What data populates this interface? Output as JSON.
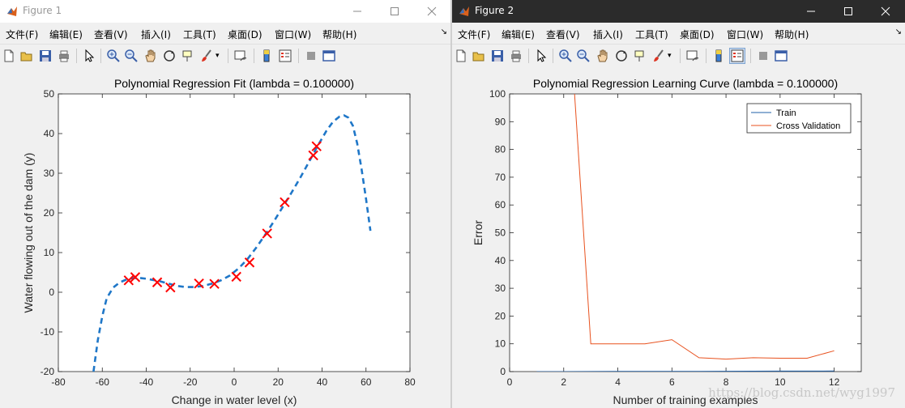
{
  "figure1": {
    "window_title": "Figure 1",
    "menu": [
      "文件(F)",
      "编辑(E)",
      "查看(V)",
      "插入(I)",
      "工具(T)",
      "桌面(D)",
      "窗口(W)",
      "帮助(H)"
    ],
    "overflow_arrow": "↘",
    "toolbar_icons": [
      "new-figure-icon",
      "open-file-icon",
      "save-icon",
      "print-icon",
      "pointer-icon",
      "zoom-in-icon",
      "zoom-out-icon",
      "pan-hand-icon",
      "rotate-3d-icon",
      "data-cursor-icon",
      "brush-icon",
      "dropdown-arrow-icon",
      "link-plot-icon",
      "colorbar-icon",
      "legend-icon",
      "hide-plot-tools-icon",
      "show-plot-tools-icon"
    ]
  },
  "figure2": {
    "window_title": "Figure 2",
    "menu": [
      "文件(F)",
      "编辑(E)",
      "查看(V)",
      "插入(I)",
      "工具(T)",
      "桌面(D)",
      "窗口(W)",
      "帮助(H)"
    ],
    "overflow_arrow": "↘",
    "watermark": "https://blog.csdn.net/wyg1997"
  },
  "chart_data": [
    {
      "type": "scatter",
      "title": "Polynomial Regression Fit (lambda = 0.100000)",
      "xlabel": "Change in water level (x)",
      "ylabel": "Water flowing out of the dam (y)",
      "xlim": [
        -80,
        80
      ],
      "ylim": [
        -20,
        50
      ],
      "xticks": [
        -80,
        -60,
        -40,
        -20,
        0,
        20,
        40,
        60,
        80
      ],
      "yticks": [
        -20,
        -10,
        0,
        10,
        20,
        30,
        40,
        50
      ],
      "grid": false,
      "series": [
        {
          "marker": "x",
          "color": "#ff0000",
          "x": [
            -48,
            -45,
            -35,
            -29,
            -16,
            -9,
            1,
            7,
            15,
            23,
            36,
            37.5
          ],
          "y": [
            3,
            3.8,
            2.5,
            1.2,
            2.2,
            2.1,
            3.9,
            7.5,
            14.8,
            22.7,
            34.5,
            36.8
          ]
        },
        {
          "style": "dashed",
          "color": "#1f77c8",
          "x": [
            -64,
            -62,
            -60,
            -58,
            -55,
            -52,
            -49,
            -46,
            -43,
            -40,
            -37,
            -34,
            -30,
            -26,
            -22,
            -18,
            -14,
            -10,
            -6,
            -2,
            2,
            6,
            10,
            14,
            18,
            22,
            26,
            30,
            34,
            38,
            42,
            45,
            48,
            50,
            52,
            54,
            56,
            58,
            60,
            62
          ],
          "y": [
            -20,
            -12,
            -6,
            -1.5,
            1.2,
            2.5,
            3.2,
            3.6,
            3.6,
            3.4,
            3.1,
            2.8,
            2.2,
            1.6,
            1.3,
            1.3,
            1.6,
            2.2,
            3.0,
            4.2,
            6.0,
            8.3,
            11.2,
            14.4,
            17.8,
            21.4,
            25.0,
            28.8,
            32.8,
            36.9,
            40.7,
            43.0,
            44.3,
            44.6,
            44.0,
            42.0,
            37.5,
            31.0,
            23.5,
            15.5
          ]
        }
      ]
    },
    {
      "type": "line",
      "title": "Polynomial Regression Learning Curve (lambda = 0.100000)",
      "xlabel": "Number of training examples",
      "ylabel": "Error",
      "xlim": [
        0,
        13
      ],
      "ylim": [
        0,
        100
      ],
      "xticks": [
        0,
        2,
        4,
        6,
        8,
        10,
        12
      ],
      "yticks": [
        0,
        10,
        20,
        30,
        40,
        50,
        60,
        70,
        80,
        90,
        100
      ],
      "grid": false,
      "legend_position": "top-right",
      "series": [
        {
          "name": "Train",
          "color": "#1f5fa8",
          "x": [
            1,
            2,
            3,
            4,
            5,
            6,
            7,
            8,
            9,
            10,
            11,
            12
          ],
          "y": [
            0,
            0,
            0.02,
            0.05,
            0.08,
            0.1,
            0.1,
            0.12,
            0.15,
            0.17,
            0.18,
            0.2
          ]
        },
        {
          "name": "Cross Validation",
          "color": "#e8521f",
          "x": [
            2,
            3,
            4,
            5,
            6,
            7,
            8,
            9,
            10,
            11,
            12
          ],
          "y": [
            160,
            10,
            10,
            10,
            11.5,
            5,
            4.5,
            5,
            4.8,
            4.8,
            7.5
          ]
        }
      ]
    }
  ]
}
